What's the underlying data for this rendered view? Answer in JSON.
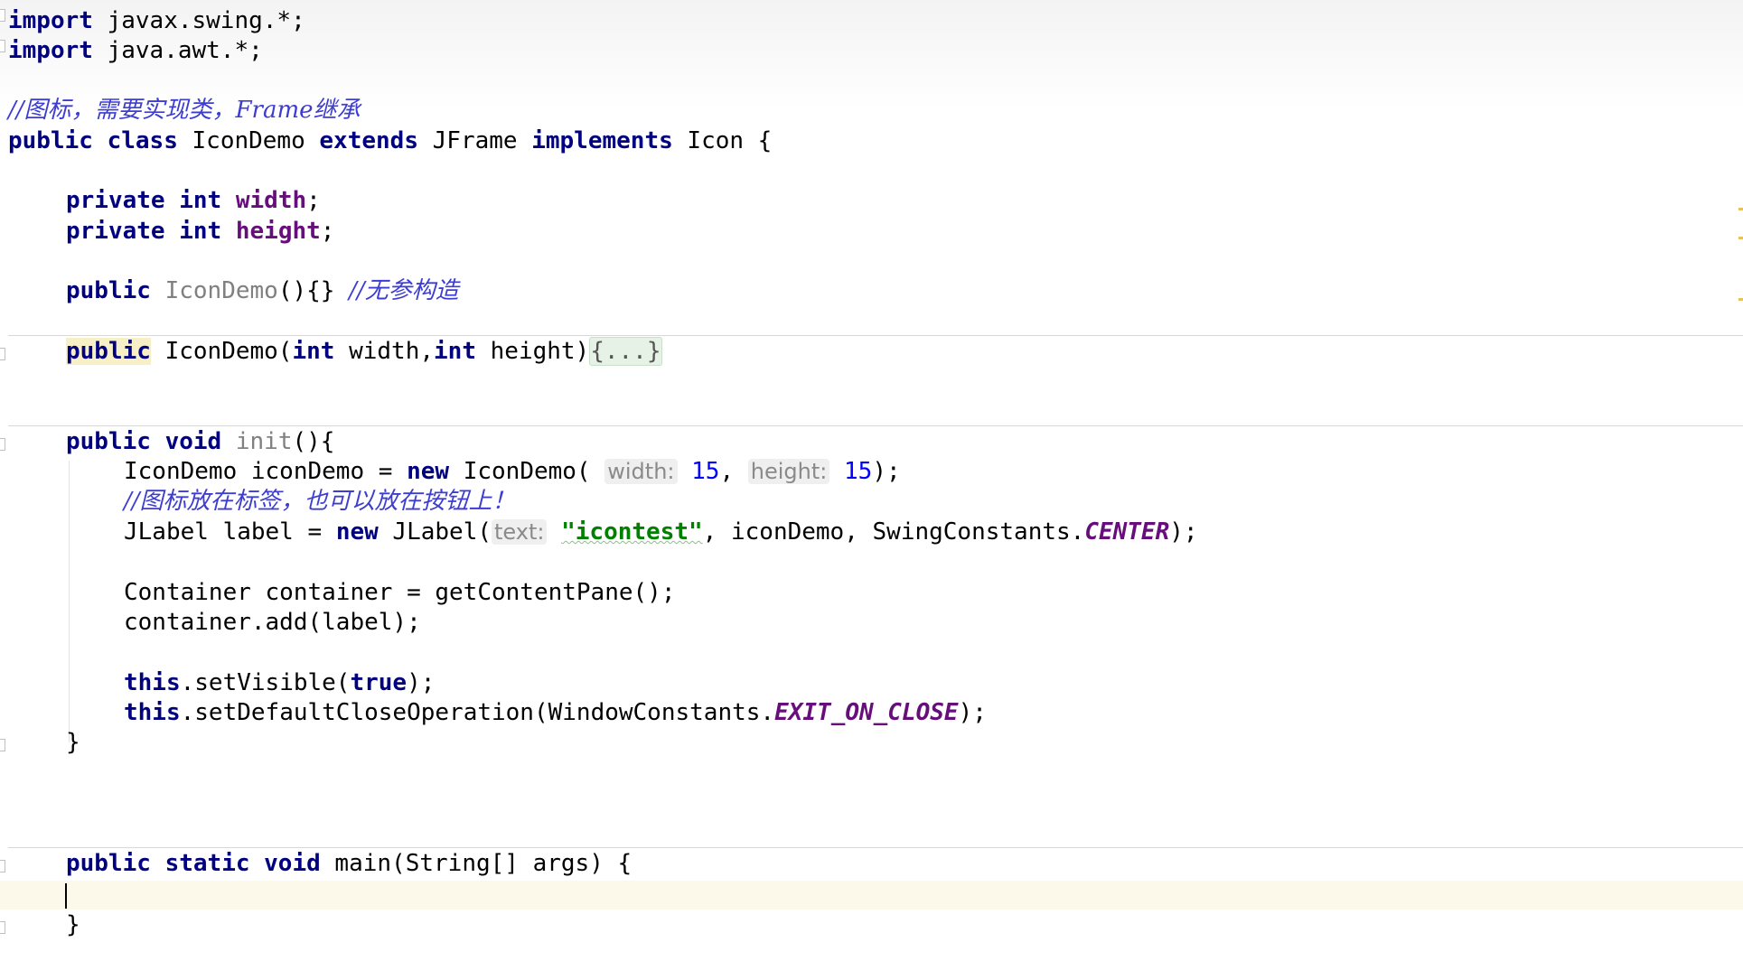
{
  "editor": {
    "lines": {
      "import_swing": {
        "kw": "import",
        "rest": " javax.swing.*;"
      },
      "import_awt": {
        "kw": "import",
        "rest": " java.awt.*;"
      },
      "comment_class": "//图标，需要实现类，Frame继承",
      "class_decl": {
        "kw1": "public",
        "kw2": "class",
        "name": " IconDemo ",
        "kw3": "extends",
        "parent": " JFrame ",
        "kw4": "implements",
        "iface": " Icon {"
      },
      "field_width": {
        "kw1": "private",
        "kw2": "int",
        "name": "width",
        "end": ";"
      },
      "field_height": {
        "kw1": "private",
        "kw2": "int",
        "name": "height",
        "end": ";"
      },
      "ctor_noarg": {
        "kw": "public",
        "name": "IconDemo",
        "body": "(){} ",
        "comment": "//无参构造"
      },
      "ctor_args": {
        "kw": "public",
        "name": " IconDemo(",
        "kw2": "int",
        "p1": " width,",
        "kw3": "int",
        "p2": " height)",
        "fold": "{...}"
      },
      "init_decl": {
        "kw1": "public",
        "kw2": "void",
        "name": "init",
        "end": "(){"
      },
      "init_l1": {
        "pre": "IconDemo iconDemo = ",
        "kw": "new",
        "call": " IconDemo(",
        "hint1": "width:",
        "v1": "15",
        "sep": ", ",
        "hint2": "height:",
        "v2": "15",
        "end": ");"
      },
      "init_comment": "//图标放在标签，也可以放在按钮上！",
      "init_l2": {
        "pre": "JLabel label = ",
        "kw": "new",
        "call": " JLabel(",
        "hint": "text:",
        "str": "\"icontest\"",
        "mid": ", iconDemo, SwingConstants.",
        "const": "CENTER",
        "end": ");"
      },
      "init_l3": "Container container = getContentPane();",
      "init_l4": "container.add(label);",
      "init_l5": {
        "kw": "this",
        "call": ".setVisible(",
        "kw2": "true",
        "end": ");"
      },
      "init_l6": {
        "kw": "this",
        "call": ".setDefaultCloseOperation(WindowConstants.",
        "const": "EXIT_ON_CLOSE",
        "end": ");"
      },
      "init_close": "}",
      "main_decl": {
        "kw1": "public",
        "kw2": "static",
        "kw3": "void",
        "rest": " main(String[] args) {"
      },
      "main_close": "}"
    }
  }
}
